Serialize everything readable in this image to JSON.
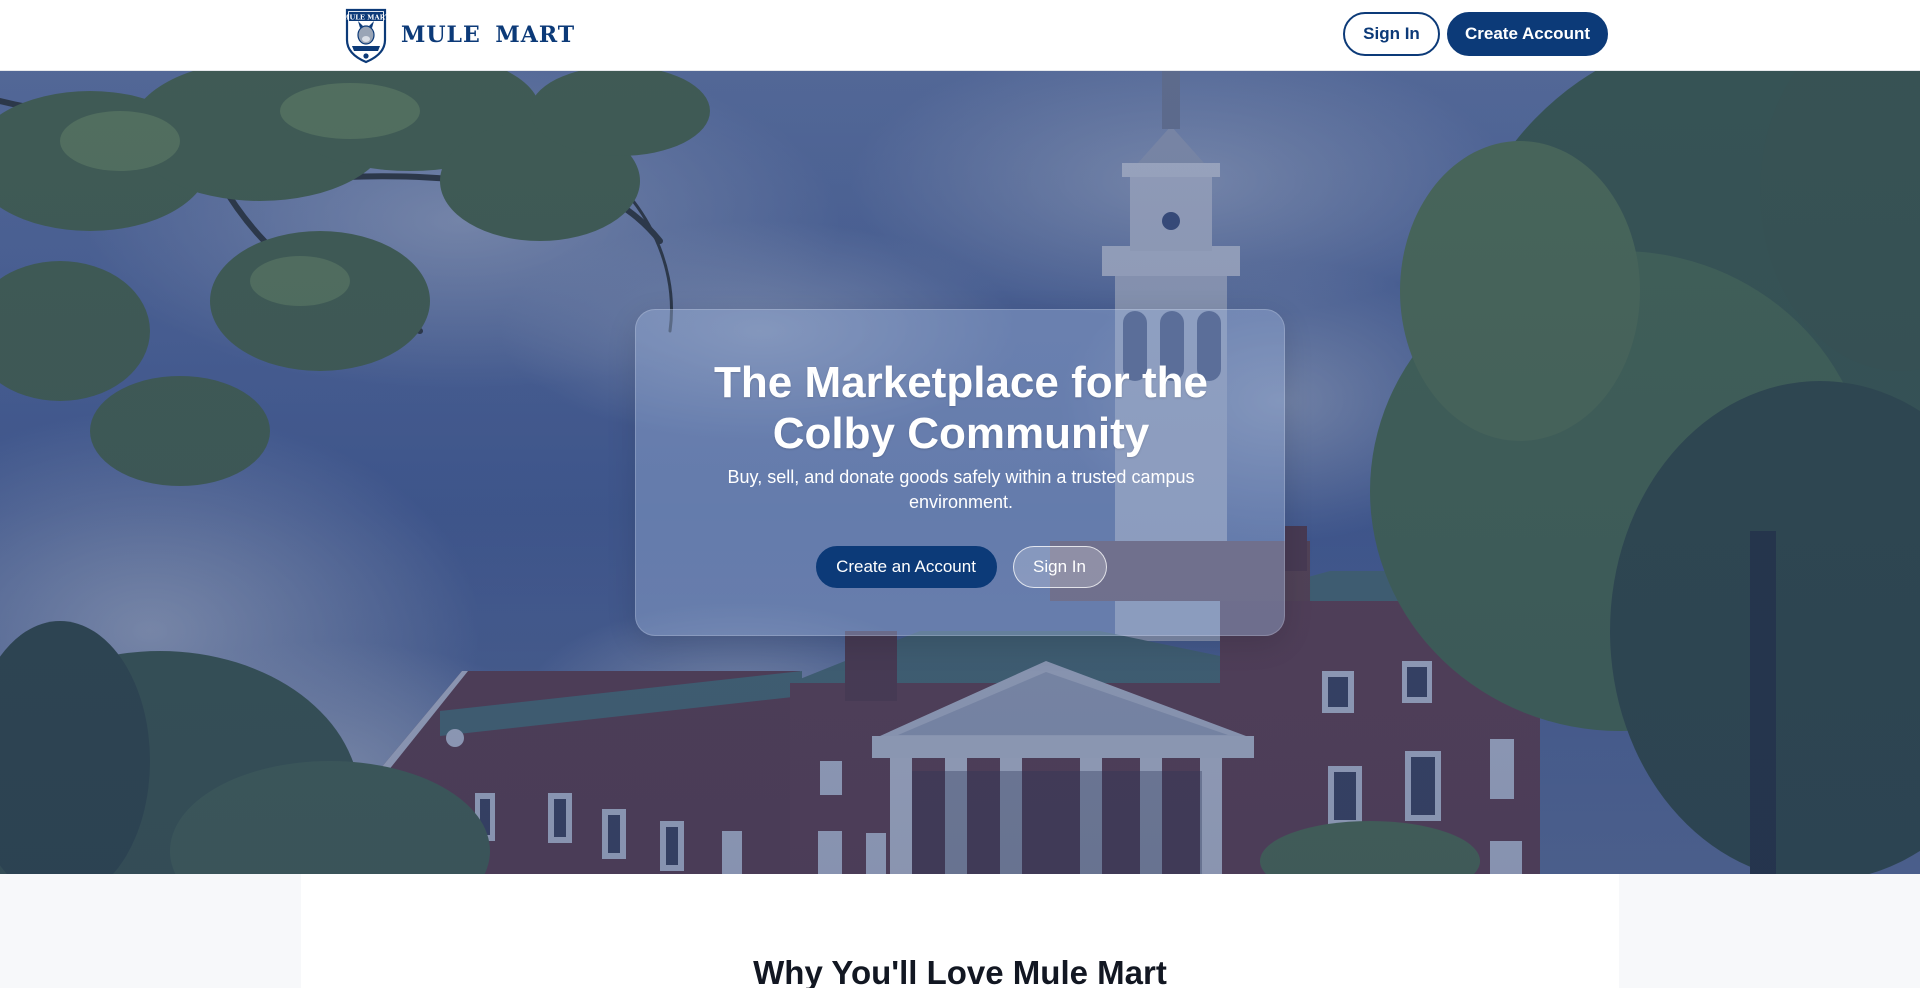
{
  "header": {
    "brand_name": "MULE  MART",
    "logo_text": "MULE MART",
    "sign_in_label": "Sign In",
    "create_account_label": "Create Account"
  },
  "hero": {
    "title": "The Marketplace for the Colby Community",
    "subtitle": "Buy, sell, and donate goods safely within a trusted campus environment.",
    "primary_cta": "Create an Account",
    "secondary_cta": "Sign In"
  },
  "features": {
    "title": "Why You'll Love Mule Mart"
  },
  "colors": {
    "brand_navy": "#0c3a78",
    "header_bg": "#ffffff",
    "page_bg": "#f7f8fa",
    "hero_overlay": "#4a6290"
  },
  "icons": {
    "logo": "shield-crest-icon"
  }
}
